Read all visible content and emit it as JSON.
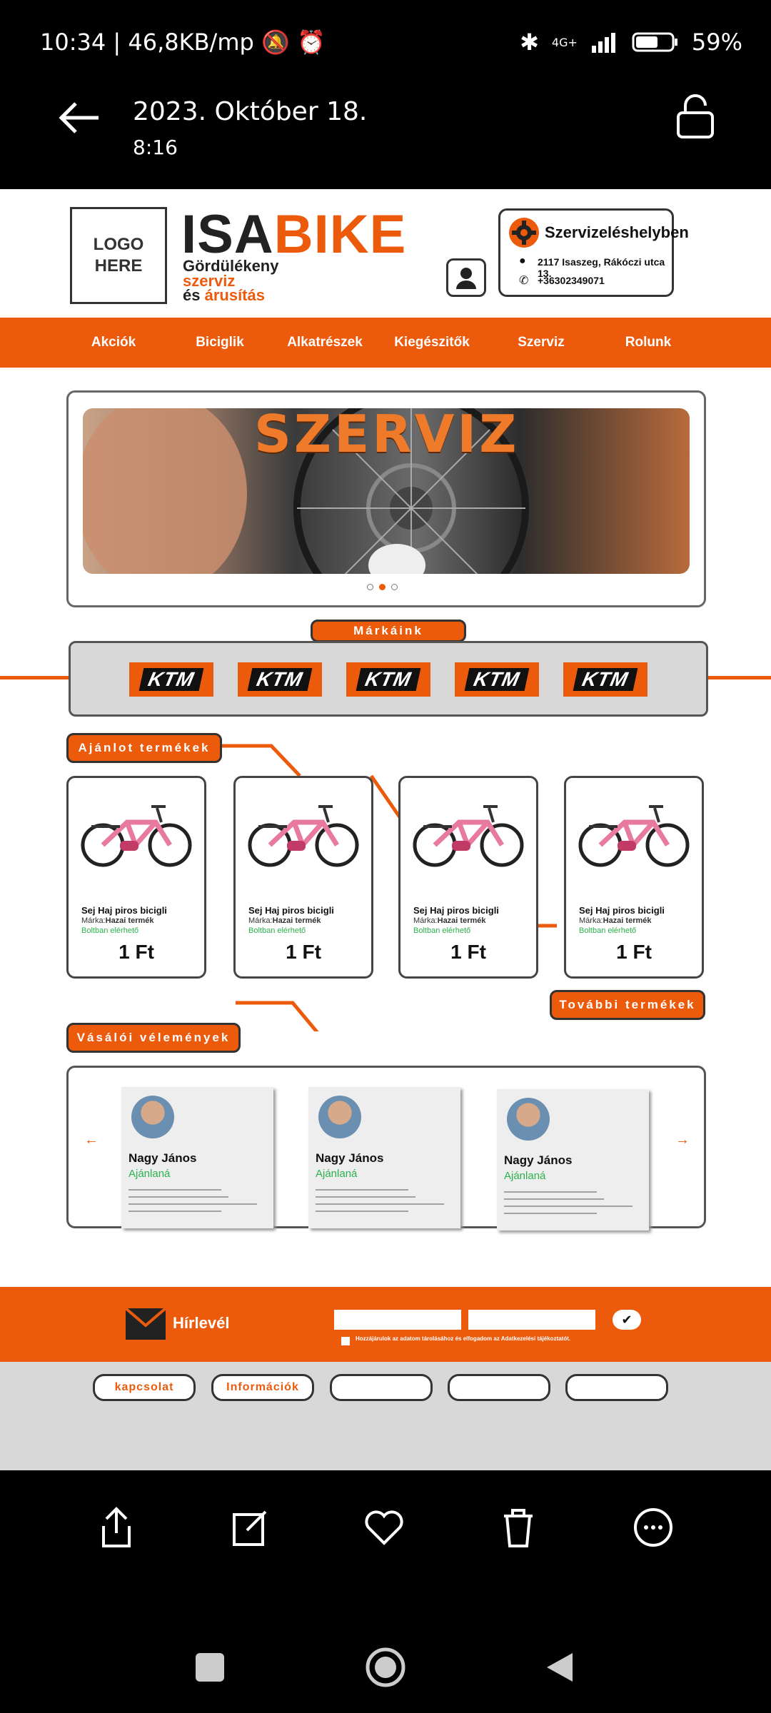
{
  "status_bar": {
    "time": "10:34",
    "speed": "46,8KB/mp",
    "network": "4G+",
    "battery": "59%"
  },
  "viewer": {
    "date": "2023. Október 18.",
    "time": "8:16"
  },
  "site": {
    "logo_placeholder": "LOGO HERE",
    "brand_part1": "ISA",
    "brand_part2": "BIKE",
    "tagline1": "Gördülékeny",
    "tagline2": "szerviz",
    "tagline3_prefix": "és ",
    "tagline3_suffix": "árusítás",
    "service": {
      "title": "Szervizeléshelyben",
      "address": "2117 Isaszeg, Rákóczi utca 13.",
      "phone": "+36302349071"
    },
    "nav": [
      "Akciók",
      "Biciglik",
      "Alkatrészek",
      "Kiegészitők",
      "Szerviz",
      "Rolunk"
    ],
    "hero_title": "SZERVIZ",
    "brands_title": "Márkáink",
    "brand_logos": [
      "KTM",
      "KTM",
      "KTM",
      "KTM",
      "KTM"
    ],
    "featured_title": "Ajánlot termékek",
    "products": [
      {
        "name": "Sej Haj piros bicigli",
        "brand_label": "Márka:",
        "brand": "Hazai termék",
        "stock": "Boltban elérhető",
        "price": "1 Ft"
      },
      {
        "name": "Sej Haj piros bicigli",
        "brand_label": "Márka:",
        "brand": "Hazai termék",
        "stock": "Boltban elérhető",
        "price": "1 Ft"
      },
      {
        "name": "Sej Haj piros bicigli",
        "brand_label": "Márka:",
        "brand": "Hazai termék",
        "stock": "Boltban elérhető",
        "price": "1 Ft"
      },
      {
        "name": "Sej Haj piros bicigli",
        "brand_label": "Márka:",
        "brand": "Hazai termék",
        "stock": "Boltban elérhető",
        "price": "1 Ft"
      }
    ],
    "more_products": "További termékek",
    "reviews_title": "Vásálói vélemények",
    "reviews": [
      {
        "name": "Nagy János",
        "rec": "Ajánlaná"
      },
      {
        "name": "Nagy János",
        "rec": "Ajánlaná"
      },
      {
        "name": "Nagy János",
        "rec": "Ajánlaná"
      }
    ],
    "newsletter": {
      "label": "Hírlevél",
      "consent": "Hozzájárulok az adatom tárolásához és elfogadom az Adatkezelési tájékoztatót."
    },
    "footer_buttons": [
      "kapcsolat",
      "Információk",
      "",
      "",
      ""
    ]
  },
  "colors": {
    "accent": "#ec5a0c",
    "dark": "#222222",
    "green": "#2bb24c"
  }
}
